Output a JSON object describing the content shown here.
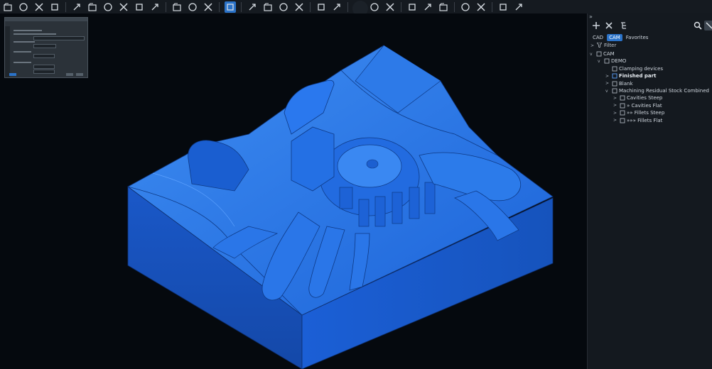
{
  "toolbar": {
    "icons": [
      "open-icon",
      "new-folder-icon",
      "save-icon",
      "print-icon",
      "close-x-icon",
      "rotate-left-icon",
      "rotate-down-icon",
      "layers-icon",
      "power-icon",
      "no-sim-icon",
      "tool-settings-icon",
      "simulate-icon",
      "simulate-alt-icon",
      "view-cube-icon",
      "copy-icon",
      "refresh-icon",
      "zoom-icon",
      "fit-icon",
      "axis-icon",
      "orient-icon",
      "orient-alt-icon",
      "grid-view-icon",
      "hash-icon",
      "section-icon",
      "eye-icon",
      "box-view-icon",
      "wrench-icon",
      "probe-icon",
      "info-icon",
      "cursor-help-icon"
    ]
  },
  "panel": {
    "expand_glyph": "»",
    "tabs": [
      "CAD",
      "CAM",
      "Favorites"
    ],
    "active_tab": "CAM",
    "filter_label": "Filter",
    "tree": [
      {
        "label": "CAM",
        "level": 0,
        "chevron": "v",
        "bold": false
      },
      {
        "label": "DEMO",
        "level": 1,
        "chevron": "v",
        "bold": false
      },
      {
        "label": "Clamping devices",
        "level": 2,
        "chevron": "",
        "bold": false
      },
      {
        "label": "Finished part",
        "level": 2,
        "chevron": ">",
        "bold": true
      },
      {
        "label": "Blank",
        "level": 2,
        "chevron": ">",
        "bold": false
      },
      {
        "label": "Machining Residual Stock Combined",
        "level": 2,
        "chevron": "v",
        "bold": false
      },
      {
        "label": "Cavities Steep",
        "level": 3,
        "chevron": ">",
        "bold": false
      },
      {
        "label": "» Cavities Flat",
        "level": 3,
        "chevron": ">",
        "bold": false
      },
      {
        "label": "»» Fillets Steep",
        "level": 3,
        "chevron": ">",
        "bold": false
      },
      {
        "label": "»»» Fillets Flat",
        "level": 3,
        "chevron": ">",
        "bold": false
      }
    ]
  },
  "accent": "#2b73c9",
  "model_color": "#1f6fe6"
}
